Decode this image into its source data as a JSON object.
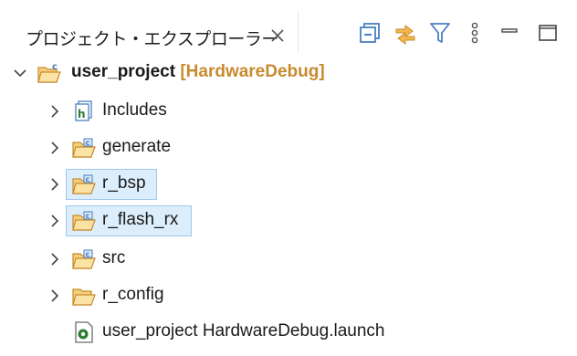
{
  "view": {
    "tab_title": "プロジェクト・エクスプローラー",
    "icons": {
      "close": "close-icon",
      "collapse_all": "collapse-all-icon",
      "link_with_editor": "link-with-editor-icon",
      "filter": "filter-icon",
      "view_menu": "view-menu-icon",
      "minimize": "minimize-icon",
      "maximize": "maximize-icon"
    }
  },
  "tree": {
    "project": {
      "name": "user_project",
      "decoration": "[HardwareDebug]",
      "expanded": true
    },
    "children": [
      {
        "label": "Includes",
        "icon": "includes-icon",
        "selected": false
      },
      {
        "label": "generate",
        "icon": "source-folder-icon",
        "selected": false
      },
      {
        "label": "r_bsp",
        "icon": "source-folder-icon",
        "selected": true
      },
      {
        "label": "r_flash_rx",
        "icon": "source-folder-icon",
        "selected": true
      },
      {
        "label": "src",
        "icon": "source-folder-icon",
        "selected": false
      },
      {
        "label": "r_config",
        "icon": "folder-icon",
        "selected": false
      },
      {
        "label": "user_project HardwareDebug.launch",
        "icon": "launch-file-icon",
        "selected": false
      }
    ]
  },
  "colors": {
    "selection_bg": "#dceefc",
    "selection_border": "#9dc8ec",
    "decoration": "#c88a2f",
    "folder": "#e0a83a",
    "accent_blue": "#4a7fc1"
  }
}
